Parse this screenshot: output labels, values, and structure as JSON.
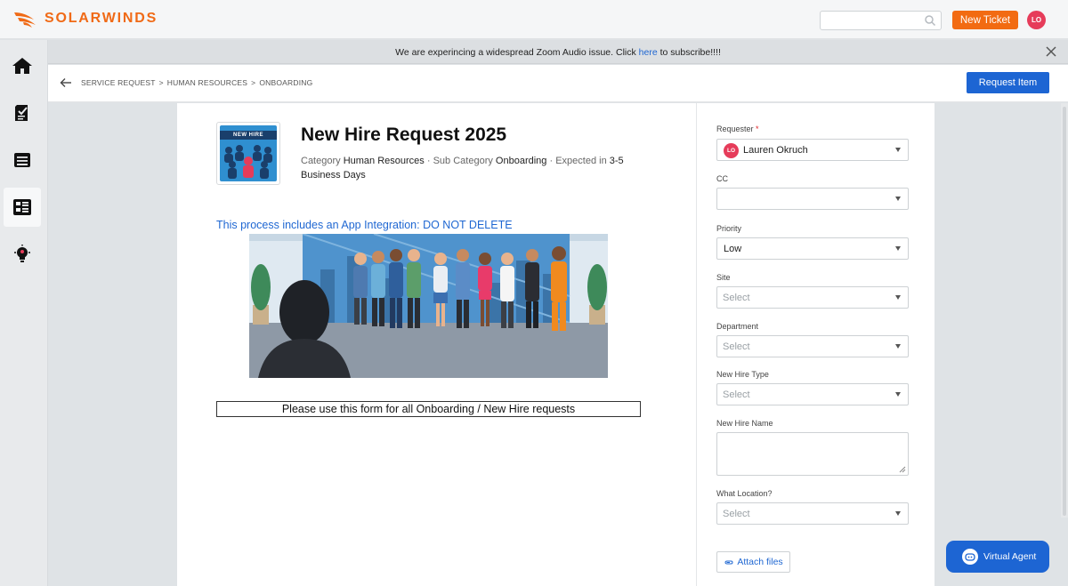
{
  "brand": {
    "name": "SOLARWINDS",
    "accent": "#f06a16"
  },
  "header": {
    "search_placeholder": "",
    "new_ticket_label": "New Ticket",
    "user_initials": "LO"
  },
  "sidebar": {
    "items": [
      {
        "icon": "home-icon",
        "active": false
      },
      {
        "icon": "tickets-icon",
        "active": false
      },
      {
        "icon": "inbox-icon",
        "active": false
      },
      {
        "icon": "service-catalog-icon",
        "active": true
      },
      {
        "icon": "ideas-bulb-icon",
        "active": false
      }
    ]
  },
  "banner": {
    "text_before": "We are experincing a widespread Zoom Audio issue.  Click ",
    "link_text": "here",
    "text_after": " to subscribe!!!!"
  },
  "breadcrumb": {
    "items": [
      "SERVICE REQUEST",
      ">",
      "HUMAN RESOURCES",
      ">",
      "ONBOARDING"
    ],
    "request_button": "Request Item"
  },
  "item": {
    "thumb_label": "NEW HIRE",
    "title": "New Hire Request 2025",
    "category_label": "Category",
    "category": "Human Resources",
    "sep1": "·",
    "subcategory_label": "Sub Category",
    "subcategory": "Onboarding",
    "sep2": "·",
    "expected_label": "Expected in",
    "expected": "3-5 Business Days",
    "integration_note": "This process includes an App Integration: DO NOT DELETE",
    "form_note": "Please use this form for all Onboarding / New Hire requests"
  },
  "form": {
    "requester_label": "Requester",
    "required_mark": "*",
    "requester_initials": "LO",
    "requester_value": "Lauren Okruch",
    "cc_label": "CC",
    "priority_label": "Priority",
    "priority_value": "Low",
    "site_label": "Site",
    "site_placeholder": "Select",
    "department_label": "Department",
    "department_placeholder": "Select",
    "new_hire_type_label": "New Hire Type",
    "new_hire_type_placeholder": "Select",
    "new_hire_name_label": "New Hire Name",
    "location_label": "What Location?",
    "location_placeholder": "Select",
    "attach_label": "Attach files"
  },
  "virtual_agent": {
    "label": "Virtual Agent"
  }
}
